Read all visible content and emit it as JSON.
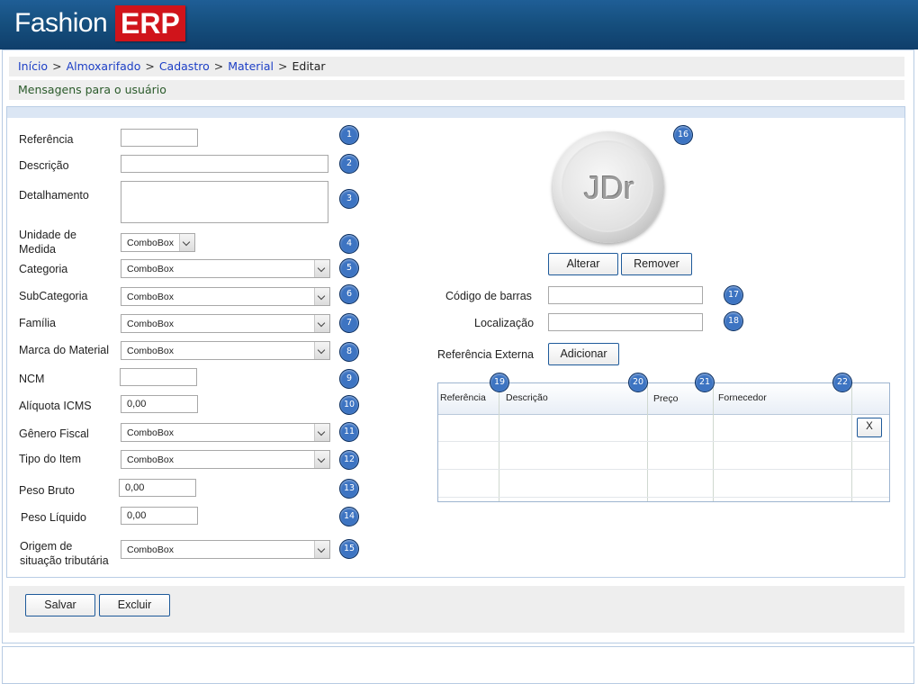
{
  "app": {
    "logo_text": "Fashion",
    "logo_badge": "ERP"
  },
  "breadcrumb": {
    "items": [
      "Início",
      "Almoxarifado",
      "Cadastro",
      "Material"
    ],
    "current": "Editar",
    "separator": ">"
  },
  "messages": {
    "label": "Mensagens para o usuário"
  },
  "form": {
    "referencia": {
      "label": "Referência",
      "value": "",
      "badge": "1"
    },
    "descricao": {
      "label": "Descrição",
      "value": "",
      "badge": "2"
    },
    "detalhamento": {
      "label": "Detalhamento",
      "value": "",
      "badge": "3"
    },
    "unidade": {
      "label_line1": "Unidade de",
      "label_line2": "Medida",
      "value": "ComboBox",
      "badge": "4"
    },
    "categoria": {
      "label": "Categoria",
      "value": "ComboBox",
      "badge": "5"
    },
    "subcategoria": {
      "label": "SubCategoria",
      "value": "ComboBox",
      "badge": "6"
    },
    "familia": {
      "label": "Família",
      "value": "ComboBox",
      "badge": "7"
    },
    "marca": {
      "label": "Marca do Material",
      "value": "ComboBox",
      "badge": "8"
    },
    "ncm": {
      "label": "NCM",
      "value": "",
      "badge": "9"
    },
    "icms": {
      "label": "Alíquota ICMS",
      "value": "0,00",
      "badge": "10"
    },
    "genero": {
      "label": "Gênero Fiscal",
      "value": "ComboBox",
      "badge": "11"
    },
    "tipo": {
      "label": "Tipo do Item",
      "value": "ComboBox",
      "badge": "12"
    },
    "peso_bruto": {
      "label": "Peso Bruto",
      "value": "0,00",
      "badge": "13"
    },
    "peso_liquido": {
      "label": "Peso Líquido",
      "value": "0,00",
      "badge": "14"
    },
    "origem": {
      "label_line1": "Origem de",
      "label_line2": "situação tributária",
      "value": "ComboBox",
      "badge": "15"
    }
  },
  "image_panel": {
    "avatar_text": "JDr",
    "badge": "16",
    "alterar_label": "Alterar",
    "remover_label": "Remover"
  },
  "codigo_barras": {
    "label": "Código de barras",
    "value": "",
    "badge": "17"
  },
  "localizacao": {
    "label": "Localização",
    "value": "",
    "badge": "18"
  },
  "referencia_externa": {
    "label": "Referência Externa",
    "button_label": "Adicionar"
  },
  "grid": {
    "columns": [
      {
        "label": "Referência",
        "badge": "19"
      },
      {
        "label": "Descrição",
        "badge": "20"
      },
      {
        "label": "Preço",
        "badge": "21"
      },
      {
        "label": "Fornecedor",
        "badge": "22"
      }
    ],
    "delete_label": "X"
  },
  "actions": {
    "salvar_label": "Salvar",
    "excluir_label": "Excluir"
  }
}
